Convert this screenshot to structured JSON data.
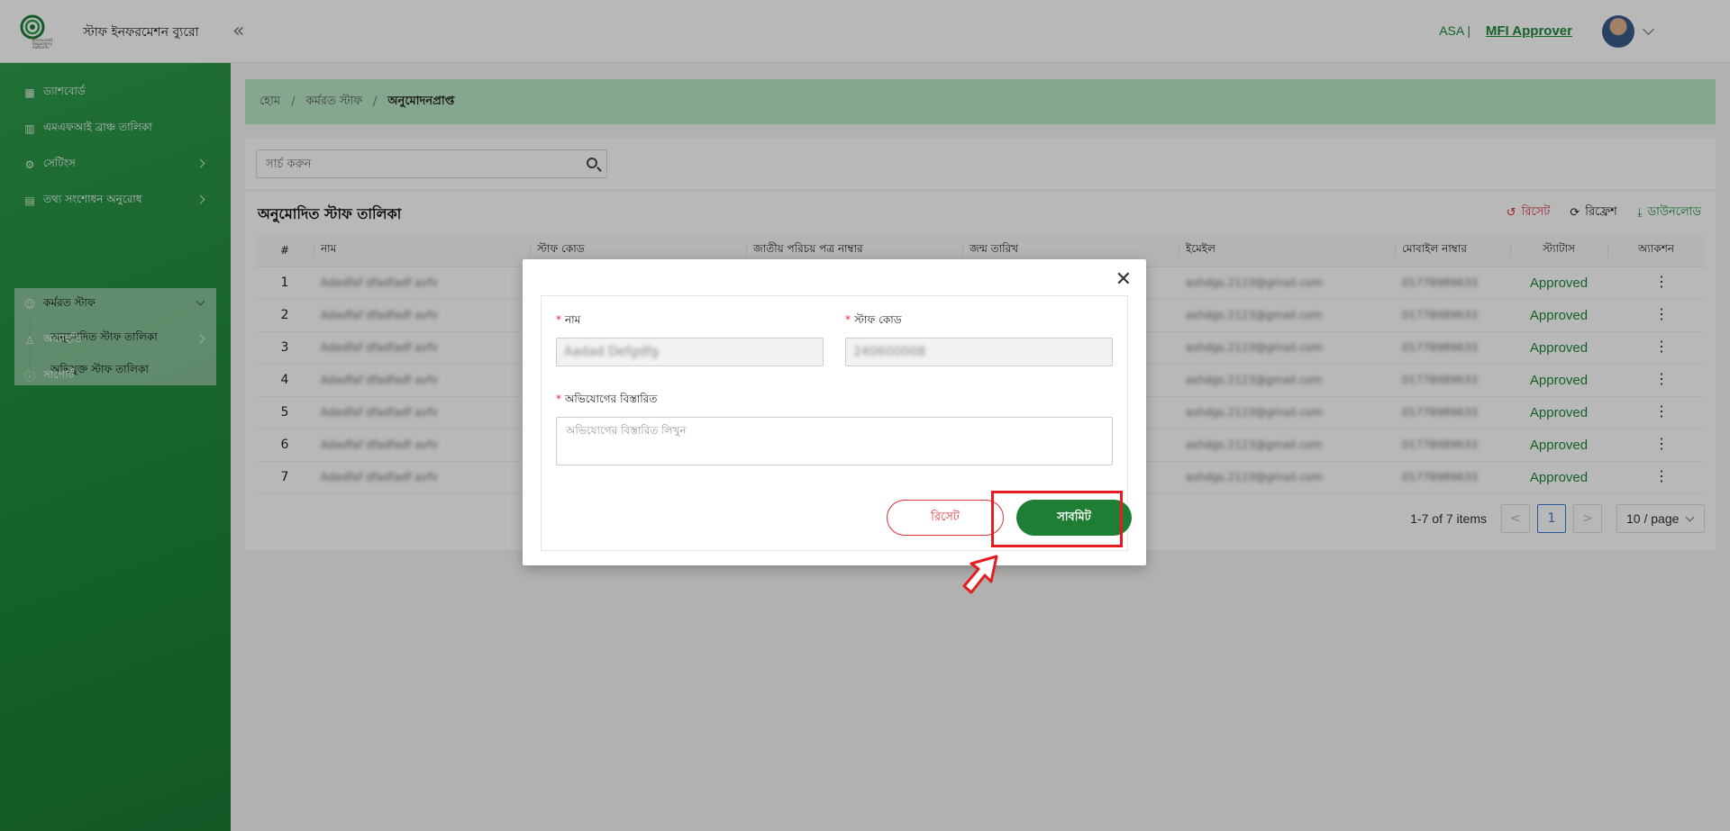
{
  "header": {
    "brand": "স্টাফ ইনফরমেশন ব্যুরো",
    "logo_text": "Microcredit Regulatory Authority",
    "collapse_icon": "«",
    "org": "ASA |",
    "role": "MFI Approver"
  },
  "sidebar": {
    "items": [
      {
        "label": "ড্যাশবোর্ড",
        "icon": "dashboard-icon"
      },
      {
        "label": "এমএফআই ব্রাঞ্চ তালিকা",
        "icon": "building-icon"
      },
      {
        "label": "সেটিংস",
        "icon": "gear-icon"
      },
      {
        "label": "তথ্য সংশোধন অনুরোধ",
        "icon": "document-icon"
      },
      {
        "label": "কর্মরত স্টাফ",
        "icon": "users-icon"
      },
      {
        "label": "অব্যাহতি",
        "icon": "user-exit-icon"
      },
      {
        "label": "সাপোর্ট",
        "icon": "info-icon"
      }
    ],
    "submenu": [
      {
        "label": "অনুমোদিত স্টাফ তালিকা"
      },
      {
        "label": "অভিযুক্ত স্টাফ তালিকা"
      }
    ]
  },
  "breadcrumb": {
    "items": [
      "হোম",
      "কর্মরত স্টাফ",
      "অনুমোদনপ্রাপ্ত"
    ],
    "separator": "/"
  },
  "search": {
    "placeholder": "সার্চ করুন"
  },
  "table": {
    "title": "অনুমোদিত স্টাফ তালিকা",
    "actions": {
      "reset": "রিসেট",
      "refresh": "রিফ্রেশ",
      "download": "ডাউনলোড"
    },
    "columns": [
      "#",
      "নাম",
      "স্টাফ কোড",
      "জাতীয় পরিচয় পত্র নাম্বার",
      "জন্ম তারিখ",
      "ইমেইল",
      "মোবাইল নাম্বার",
      "স্ট্যাটাস",
      "অ্যাকশন"
    ],
    "rows": [
      {
        "index": "1",
        "name": "Adadfaf dfadfadf avfv",
        "email": "ashdgs.2123@gmail.com",
        "mobile": "01778989633",
        "status": "Approved"
      },
      {
        "index": "2",
        "name": "Adadfaf dfadfadf avfv",
        "email": "ashdgs.2123@gmail.com",
        "mobile": "01778989633",
        "status": "Approved"
      },
      {
        "index": "3",
        "name": "Adadfaf dfadfadf avfv",
        "email": "ashdgs.2123@gmail.com",
        "mobile": "01778989633",
        "status": "Approved"
      },
      {
        "index": "4",
        "name": "Adadfaf dfadfadf avfv",
        "email": "ashdgs.2123@gmail.com",
        "mobile": "01778989633",
        "status": "Approved"
      },
      {
        "index": "5",
        "name": "Adadfaf dfadfadf avfv",
        "email": "ashdgs.2123@gmail.com",
        "mobile": "01778989633",
        "status": "Approved"
      },
      {
        "index": "6",
        "name": "Adadfaf dfadfadf avfv",
        "email": "ashdgs.2123@gmail.com",
        "mobile": "01778989633",
        "status": "Approved"
      },
      {
        "index": "7",
        "name": "Adadfaf dfadfadf avfv",
        "email": "ashdgs.2123@gmail.com",
        "mobile": "01778989633",
        "status": "Approved"
      }
    ]
  },
  "pagination": {
    "total": "1-7 of 7 items",
    "prev": "<",
    "current": "1",
    "next": ">",
    "page_size": "10 / page"
  },
  "modal": {
    "close": "✕",
    "required_mark": "*",
    "name_label": "নাম",
    "name_value": "Aadad Defgdfg",
    "code_label": "স্টাফ কোড",
    "code_value": "240600008",
    "details_label": "অভিযোগের বিস্তারিত",
    "details_placeholder": "অভিযোগের বিস্তারিত লিখুন",
    "reset_label": "রিসেট",
    "submit_label": "সাবমিট"
  },
  "colors": {
    "primary_green": "#1e7f34",
    "sidebar_green": "#1e8a3c",
    "breadcrumb_bg": "#b9e8c5",
    "status_green": "#1e8a3a",
    "danger_red": "#e0303a",
    "highlight_red": "#e61c23"
  }
}
